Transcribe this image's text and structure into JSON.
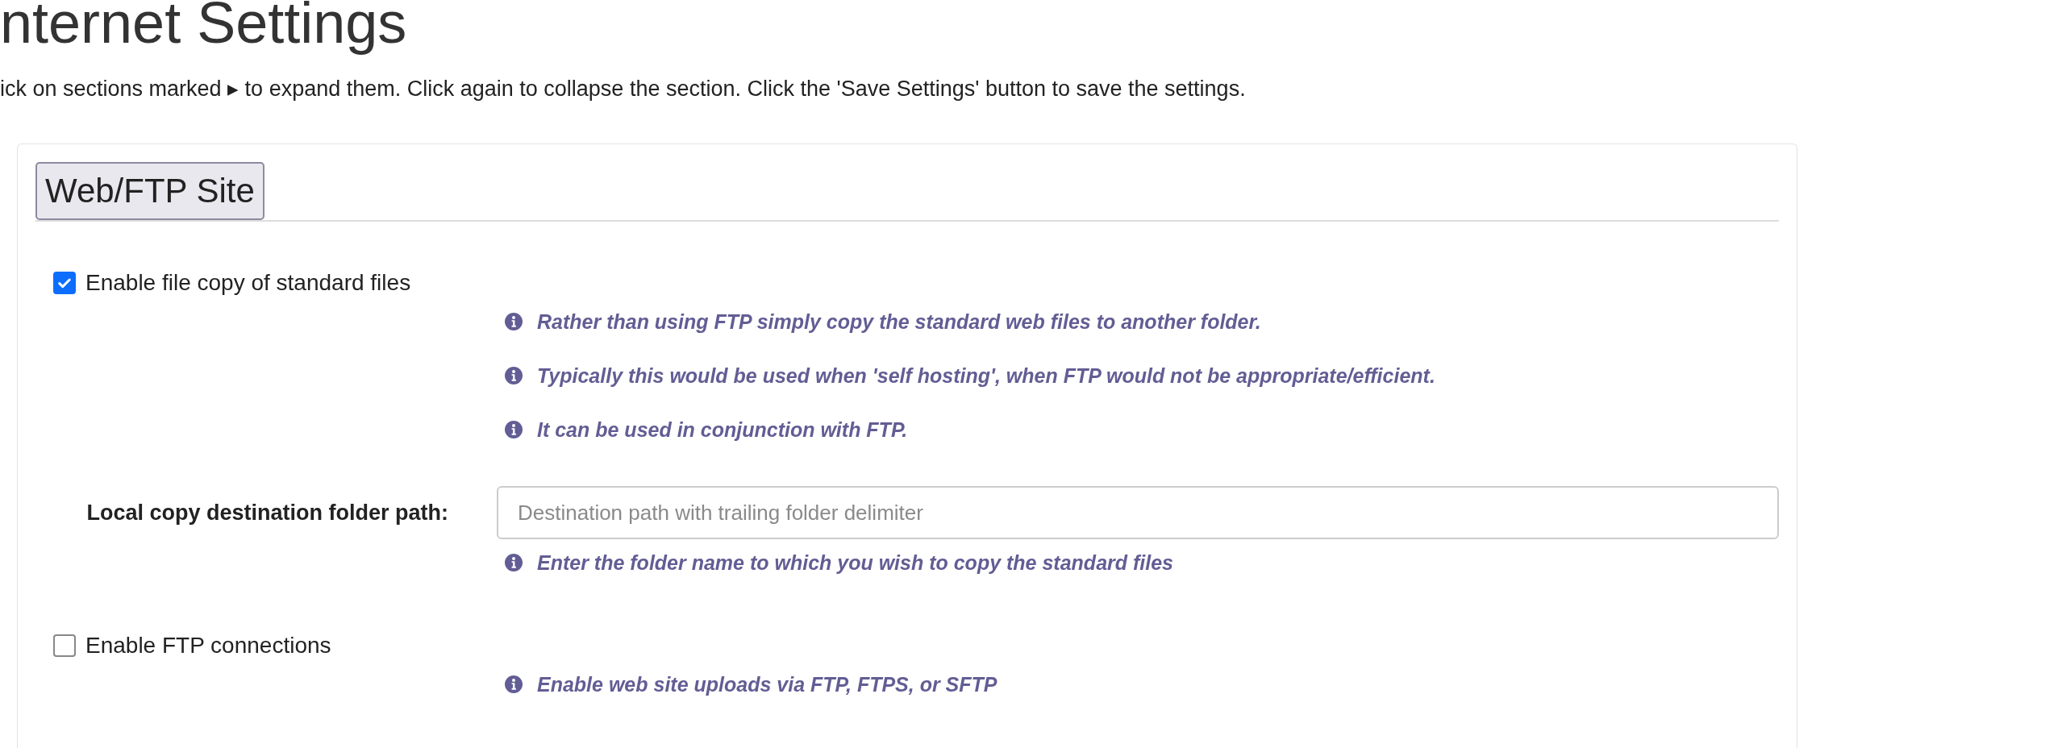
{
  "page": {
    "title": "nternet Settings",
    "intro": "ick on sections marked ▸ to expand them. Click again to collapse the section. Click the 'Save Settings' button to save the settings."
  },
  "section": {
    "title": "Web/FTP Site",
    "rows": [
      {
        "kind": "checkbox",
        "label": "Enable file copy of standard files",
        "checked": true,
        "help": [
          "Rather than using FTP simply copy the standard web files to another folder.",
          "Typically this would be used when 'self hosting', when FTP would not be appropriate/efficient.",
          "It can be used in conjunction with FTP."
        ]
      },
      {
        "kind": "text",
        "label": "Local copy destination folder path:",
        "placeholder": "Destination path with trailing folder delimiter",
        "help": [
          "Enter the folder name to which you wish to copy the standard files"
        ]
      },
      {
        "kind": "checkbox",
        "label": "Enable FTP connections",
        "checked": false,
        "help": [
          "Enable web site uploads via FTP, FTPS, or SFTP"
        ]
      }
    ]
  }
}
